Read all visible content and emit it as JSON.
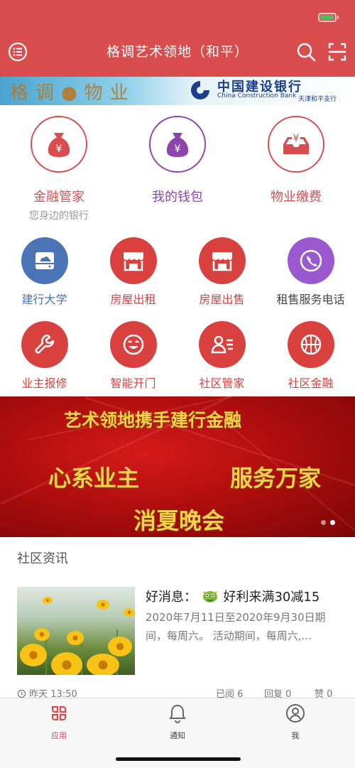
{
  "header": {
    "title": "格调艺术领地（和平）",
    "bg_color": "#d94d4f",
    "menu_icon": "list-icon",
    "search_icon": "search-icon",
    "scan_icon": "scan-icon"
  },
  "top_banner": {
    "left_text": "格调●物业",
    "bank_name": "中国建设银行",
    "bank_name_en": "China Construction Bank",
    "bank_branch": "天津和平支行"
  },
  "main_services": [
    {
      "label": "金融管家",
      "sublabel": "您身边的银行",
      "icon": "money-bag-icon",
      "color": "#d94d4f"
    },
    {
      "label": "我的钱包",
      "icon": "money-bag-icon",
      "color": "#8e44ad"
    },
    {
      "label": "物业缴费",
      "icon": "inbox-yen-icon",
      "color": "#d94d4f"
    }
  ],
  "services_row1": [
    {
      "label": "建行大学",
      "icon": "drive-icon",
      "color": "#4a74b5",
      "label_color": "#4a74b5"
    },
    {
      "label": "房屋出租",
      "icon": "store-icon",
      "color": "#d9413f",
      "label_color": "#d9413f"
    },
    {
      "label": "房屋出售",
      "icon": "store-icon",
      "color": "#d9413f",
      "label_color": "#d9413f"
    },
    {
      "label": "租售服务电话",
      "icon": "phone-icon",
      "color": "#9b59d0",
      "label_color": "#444"
    }
  ],
  "services_row2": [
    {
      "label": "业主报修",
      "icon": "wrench-icon",
      "color": "#d9413f"
    },
    {
      "label": "智能开门",
      "icon": "smile-icon",
      "color": "#d9413f"
    },
    {
      "label": "社区管家",
      "icon": "person-card-icon",
      "color": "#d9413f"
    },
    {
      "label": "社区金融",
      "icon": "basketball-icon",
      "color": "#d9413f"
    }
  ],
  "promo": {
    "line1": "艺术领地携手建行金融",
    "line2_left": "心系业主",
    "line2_right": "服务万家",
    "line3": "消夏晚会"
  },
  "news": {
    "section_title": "社区资讯",
    "title_prefix": "好消息：",
    "title_suffix": "好利来满30减15",
    "description": "2020年7月11日至2020年9月30日期间，每周六。 活动期间，每周六,...",
    "time": "昨天 13:50",
    "reads": "已阅 6",
    "replies": "回复  0",
    "likes": "赞  0"
  },
  "tabbar": [
    {
      "label": "应用",
      "icon": "apps-icon",
      "active": true
    },
    {
      "label": "通知",
      "icon": "bell-icon",
      "active": false
    },
    {
      "label": "我",
      "icon": "user-icon",
      "active": false
    }
  ]
}
